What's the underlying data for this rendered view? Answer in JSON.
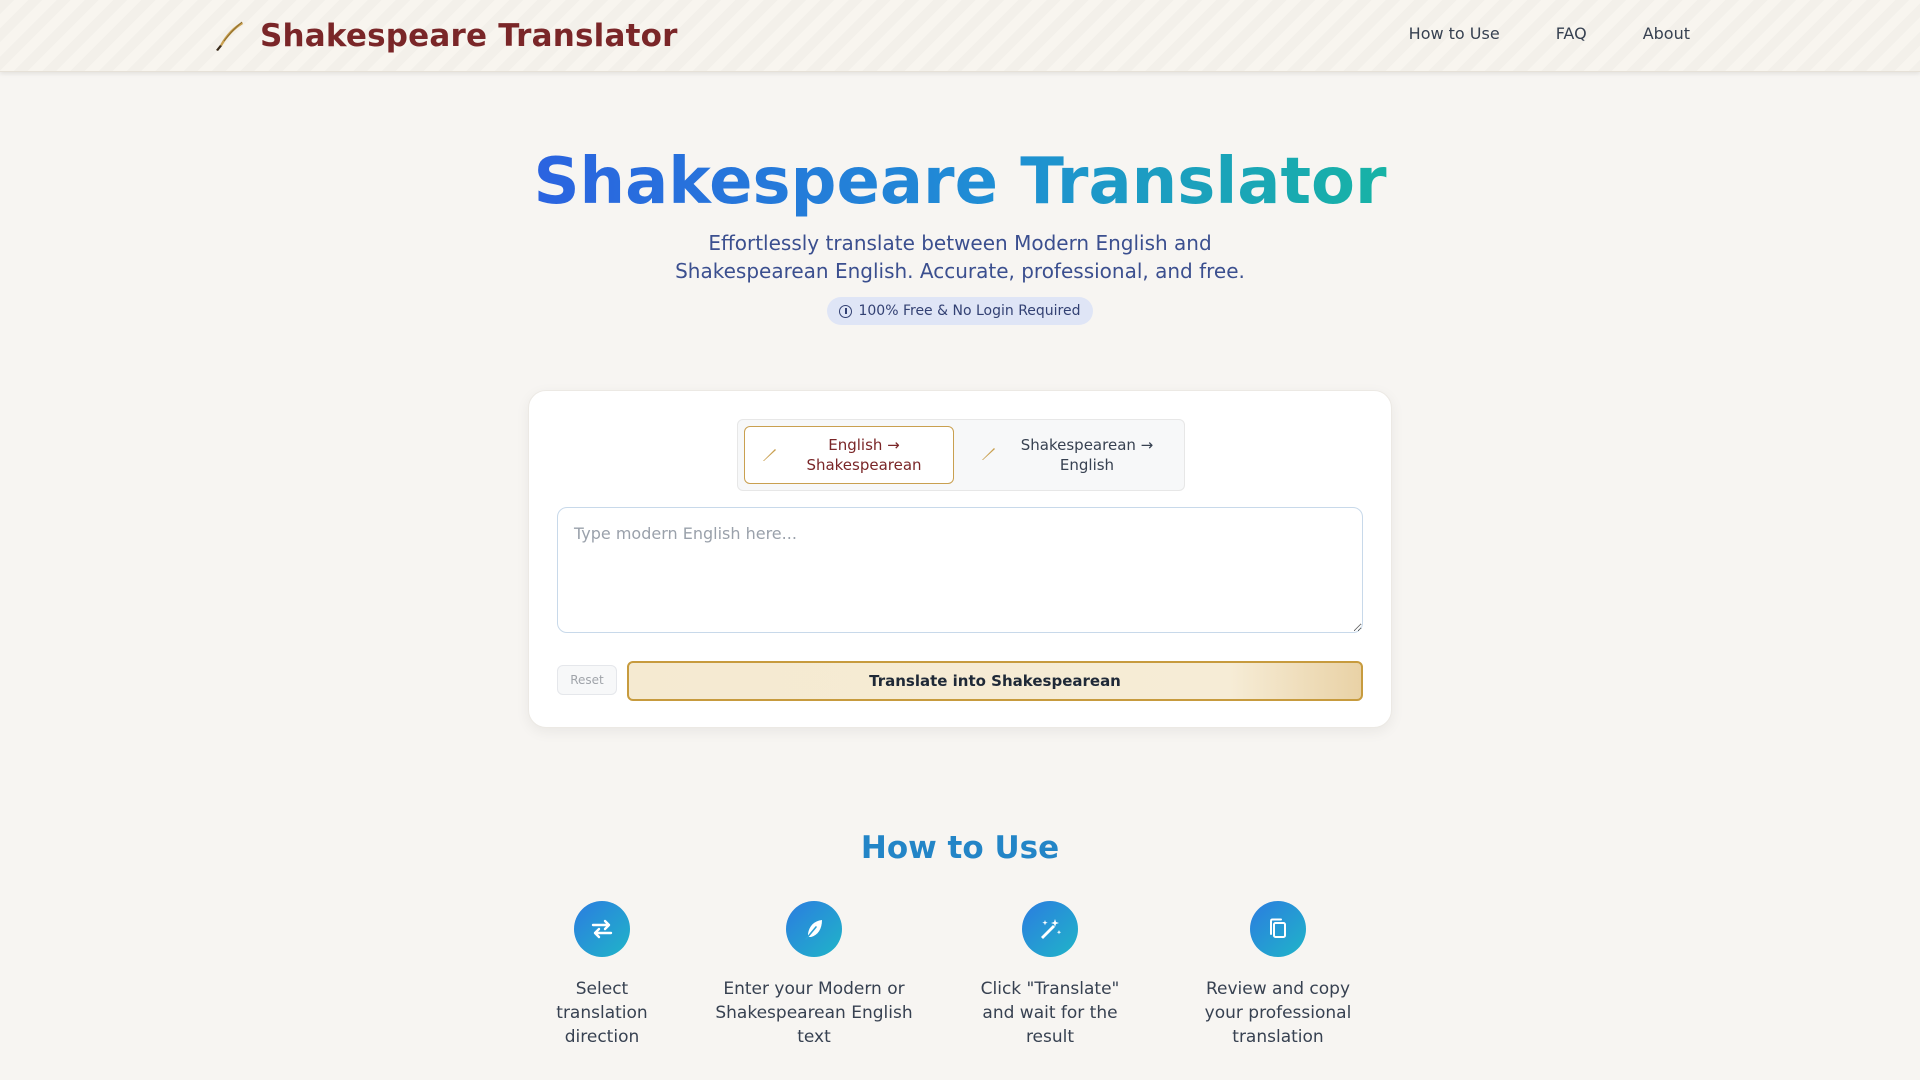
{
  "header": {
    "logo_text": "Shakespeare Translator",
    "nav": [
      "How to Use",
      "FAQ",
      "About"
    ]
  },
  "hero": {
    "title_part1": "Shakespeare",
    "title_part2": "Translator",
    "subtitle": "Effortlessly translate between Modern English and Shakespearean English. Accurate, professional, and free.",
    "badge": "100% Free & No Login Required"
  },
  "translator": {
    "tabs": [
      {
        "label": "English → Shakespearean",
        "active": true
      },
      {
        "label": "Shakespearean → English",
        "active": false
      }
    ],
    "input_value": "",
    "input_placeholder": "Type modern English here...",
    "reset_label": "Reset",
    "translate_label": "Translate into Shakespearean"
  },
  "how_to_use": {
    "title": "How to Use",
    "steps": [
      {
        "icon": "swap-arrows-icon",
        "text": "Select translation direction"
      },
      {
        "icon": "feather-icon",
        "text": "Enter your Modern or Shakespearean English text"
      },
      {
        "icon": "magic-wand-icon",
        "text": "Click \"Translate\" and wait for the result"
      },
      {
        "icon": "copy-icon",
        "text": "Review and copy your professional translation"
      }
    ]
  },
  "colors": {
    "brand": "#7a2628",
    "accent_gold": "#c79b3e",
    "accent_blue": "#2385c7",
    "page_bg": "#f7f5f2"
  }
}
